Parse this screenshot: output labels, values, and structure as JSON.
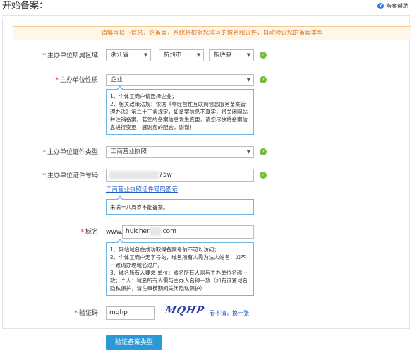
{
  "page": {
    "title": "开始备案：",
    "help_label": "备案帮助",
    "notice": "请填写以下信息开始备案，系统将根据您填写的域名和证件，自动验证您的备案类型"
  },
  "region": {
    "label": "主办单位所属区域:",
    "province": "浙江省",
    "city": "杭州市",
    "county": "桐庐县"
  },
  "nature": {
    "label": "主办单位性质:",
    "value": "企业",
    "tip": [
      "1、个体工商户请选择企业；",
      "2、相关政策法规：依据《非经营性互联网信息服务备案管理办法》第二十三条规定，如备案信息不真实，将关闭网站并注销备案。若您的备案信息发生变更，请您尽快将备案信息进行变更，感谢您的配合，谢谢！"
    ]
  },
  "cert_type": {
    "label": "主办单位证件类型:",
    "value": "工商营业执照"
  },
  "cert_no": {
    "label": "主办单位证件号码:",
    "value_suffix": "75w",
    "sample_link": "工商营业执照证件号码图示",
    "tip": "未满十八周岁不能备案。"
  },
  "domain": {
    "label": "域名:",
    "prefix": "www.",
    "value_start": "huicher",
    "value_end": ".com",
    "tip": [
      "1、网站域名在成功取得备案号前不可以访问；",
      "2、个体工商户无字号的，域名所有人需为法人姓名，如不一致请办理域名过户。",
      "3、域名所有人要求 单位：域名所有人需与主办单位名称一致；个人：域名所有人需与主办人名称一致（如有设置域名隐私保护，请在审核期间关闭隐私保护）"
    ]
  },
  "captcha": {
    "label": "验证码:",
    "value": "mqhp",
    "image_text": "MQHP",
    "refresh": "看不清，换一张"
  },
  "submit_label": "验证备案类型",
  "colors": {
    "accent": "#2a99d8",
    "required": "#d33333",
    "ok": "#7ab83a",
    "notice_text": "#e07a2c"
  }
}
